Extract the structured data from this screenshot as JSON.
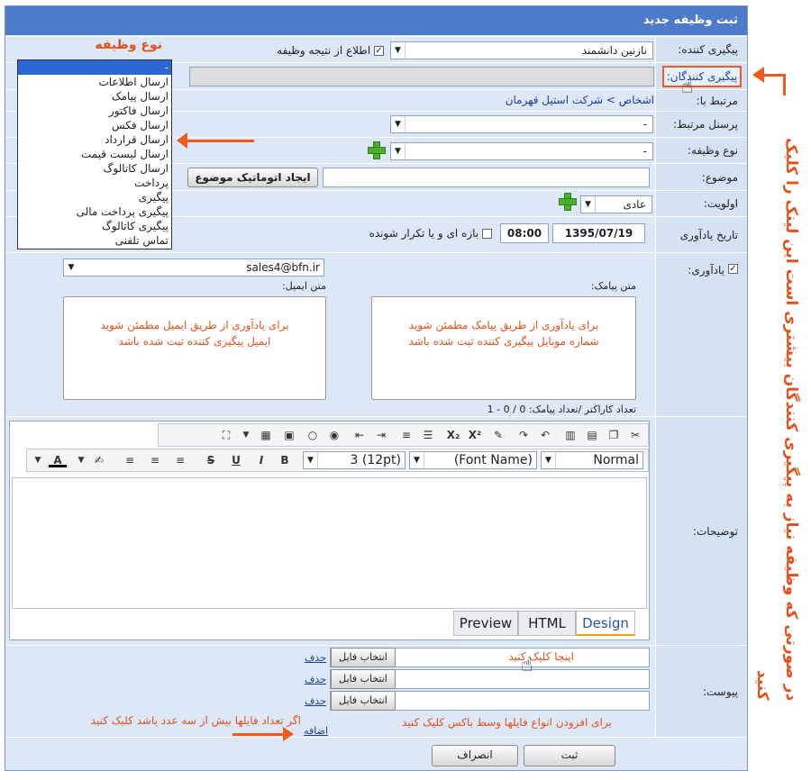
{
  "window": {
    "title": "ثبت وظیفه جدید"
  },
  "form": {
    "follower": {
      "label": "پیگیری کننده:",
      "value": "نازنین دانشمند",
      "notify_label": "اطلاع از نتیجه وظیفه"
    },
    "followers_link": {
      "label": "پیگیری کنندگان:"
    },
    "related": {
      "label": "مرتبط با:",
      "value": "اشخاص > شرکت استیل قهرمان"
    },
    "related_person": {
      "label": "پرسنل مرتبط:",
      "value": "-"
    },
    "task_type": {
      "label": "نوع وظیفه:",
      "value": "-",
      "options": [
        "-",
        "ارسال اطلاعات",
        "ارسال پیامک",
        "ارسال فاکتور",
        "ارسال فکس",
        "ارسال قرارداد",
        "ارسال لیست قیمت",
        "ارسال کاتالوگ",
        "پرداخت",
        "پیگیری",
        "پیگیری پرداخت مالی",
        "پیگیری کاتالوگ",
        "تماس تلفنی"
      ]
    },
    "subject": {
      "label": "موضوع:",
      "auto_button": "ایجاد اتوماتیک موضوع"
    },
    "priority": {
      "label": "اولویت:",
      "value": "عادی"
    },
    "reminder_date": {
      "label": "تاریخ یادآوری",
      "date": "1395/07/19",
      "time": "08:00",
      "repeat_label": "بازه ای و یا تکرار شونده"
    },
    "reminder": {
      "label": "یادآوری:",
      "email_value": "sales4@bfn.ir",
      "sms_label": "متن پیامک:",
      "email_label": "متن ایمیل:",
      "sms_note_1": "برای یادآوری از طریق پیامک مطمئن شوید",
      "sms_note_2": "شماره موبایل پیگیری کننده ثبت شده باشد",
      "email_note_1": "برای یادآوری از طریق ایمیل مطمئن شوید",
      "email_note_2": "ایمیل پیگیری کننده ثبت شده باشد",
      "counter": "تعداد کاراکتر /تعداد پیامک: 0 / 0 - 1"
    },
    "description": {
      "label": "توضیحات:",
      "format": "Normal",
      "font_name": "(Font Name)",
      "font_size": "3 (12pt)",
      "tabs": [
        "Design",
        "HTML",
        "Preview"
      ]
    },
    "attachments": {
      "label": "پیوست:",
      "choose_file": "انتخاب فایل",
      "delete": "حذف",
      "add": "اضافه",
      "click_here": "اینجا کلیک کنید",
      "note_box": "برای افزودن انواع فایلها وسط باکس کلیک کنید",
      "note_add": "اگر تعداد فایلها بیش از سه عدد باشد کلیک کنید"
    },
    "buttons": {
      "submit": "ثبت",
      "cancel": "انصراف"
    }
  },
  "annotations": {
    "task_type_title": "نوع وظیفه",
    "side_note": "در صورتی که وظیفه نیاز به پیگیری کنندگان بیشتری است این لینک را کلیک کنید"
  },
  "colors": {
    "titlebar": "#4d7bc9",
    "annotation": "#e8501a",
    "link": "#1a3ca8"
  }
}
